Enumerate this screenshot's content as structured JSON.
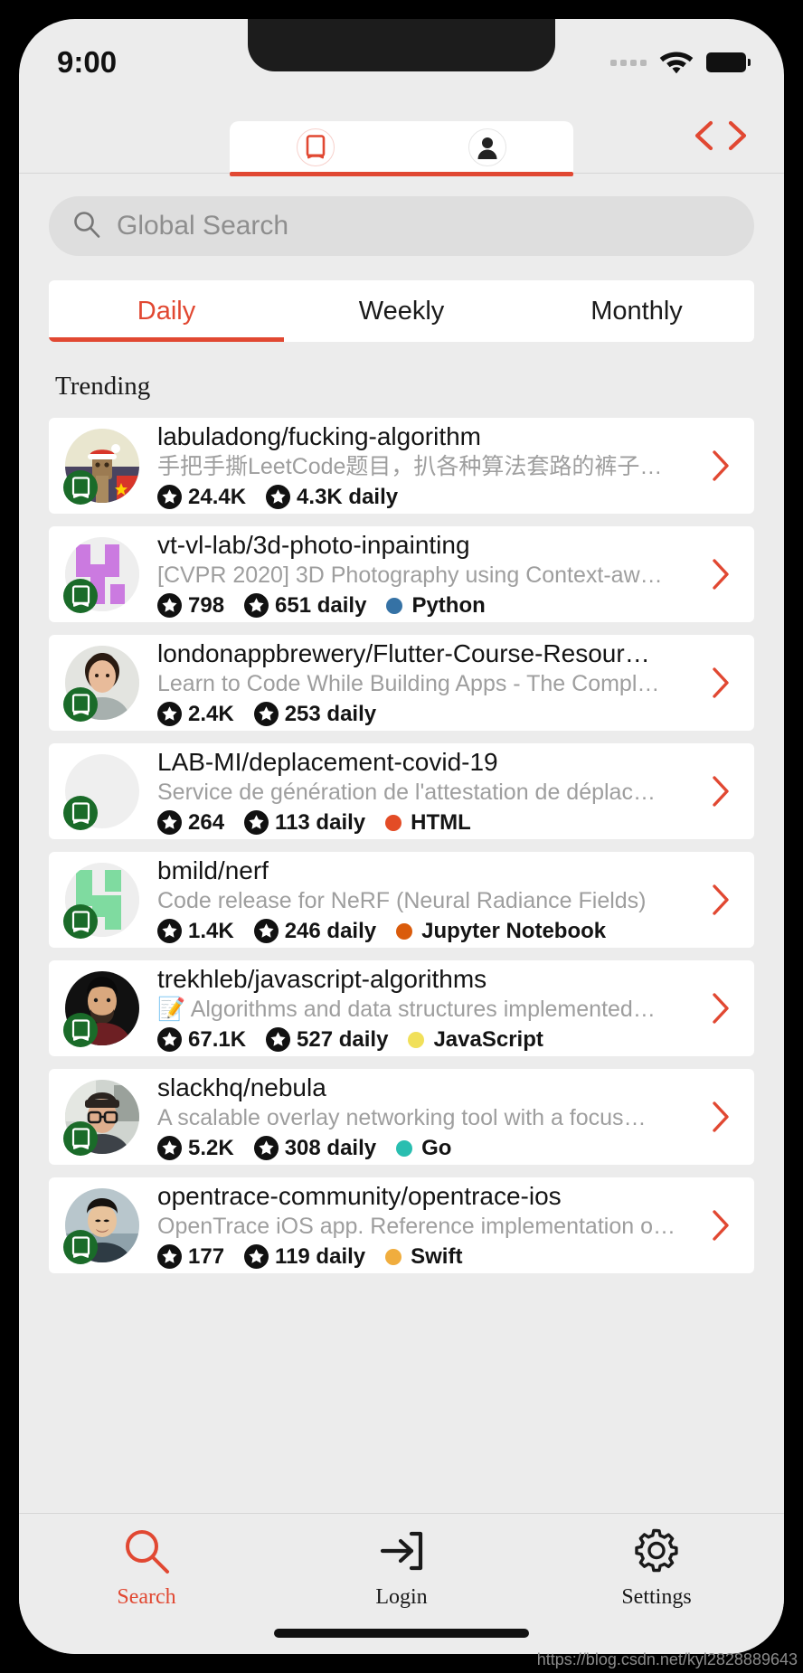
{
  "status_bar": {
    "time": "9:00",
    "signal_icon": "signal-dots-icon",
    "wifi_icon": "wifi-icon",
    "battery_icon": "battery-full-icon"
  },
  "top_tabs": {
    "items": [
      {
        "id": "repos",
        "icon": "book-icon",
        "active": true
      },
      {
        "id": "profile",
        "icon": "person-icon",
        "active": false
      }
    ],
    "code_icon": "code-brackets-icon"
  },
  "search": {
    "placeholder": "Global Search",
    "value": "",
    "icon": "search-icon"
  },
  "period_tabs": {
    "items": [
      {
        "label": "Daily",
        "active": true
      },
      {
        "label": "Weekly",
        "active": false
      },
      {
        "label": "Monthly",
        "active": false
      }
    ]
  },
  "section": {
    "title": "Trending"
  },
  "colors": {
    "accent": "#e14832",
    "badge_green": "#1a6b29",
    "background": "#ececec",
    "card": "#ffffff",
    "muted_text": "#9e9e9e"
  },
  "repos": [
    {
      "name": "labuladong/fucking-algorithm",
      "description": "手把手撕LeetCode题目，扒各种算法套路的裤子…",
      "stars": "24.4K",
      "daily": "4.3K daily",
      "language": "",
      "language_color": "",
      "avatar_style": "danbo-santa",
      "chevron_icon": "chevron-right-icon",
      "badge_icon": "book-badge-icon"
    },
    {
      "name": "vt-vl-lab/3d-photo-inpainting",
      "description": "[CVPR 2020] 3D Photography using Context-aw…",
      "stars": "798",
      "daily": "651 daily",
      "language": "Python",
      "language_color": "#3572a5",
      "avatar_style": "purple-glyph",
      "chevron_icon": "chevron-right-icon",
      "badge_icon": "book-badge-icon"
    },
    {
      "name": "londonappbrewery/Flutter-Course-Resour…",
      "description": "Learn to Code While Building Apps - The Compl…",
      "stars": "2.4K",
      "daily": "253 daily",
      "language": "",
      "language_color": "",
      "avatar_style": "person-photo-1",
      "chevron_icon": "chevron-right-icon",
      "badge_icon": "book-badge-icon"
    },
    {
      "name": "LAB-MI/deplacement-covid-19",
      "description": "Service de génération de l'attestation de déplac…",
      "stars": "264",
      "daily": "113 daily",
      "language": "HTML",
      "language_color": "#e34c26",
      "avatar_style": "none",
      "chevron_icon": "chevron-right-icon",
      "badge_icon": "book-badge-icon"
    },
    {
      "name": "bmild/nerf",
      "description": "Code release for NeRF (Neural Radiance Fields)",
      "stars": "1.4K",
      "daily": "246 daily",
      "language": "Jupyter Notebook",
      "language_color": "#da5b0b",
      "avatar_style": "green-glyph",
      "chevron_icon": "chevron-right-icon",
      "badge_icon": "book-badge-icon"
    },
    {
      "name": "trekhleb/javascript-algorithms",
      "description": "📝 Algorithms and data structures implemented…",
      "stars": "67.1K",
      "daily": "527 daily",
      "language": "JavaScript",
      "language_color": "#f1e05a",
      "avatar_style": "person-photo-2",
      "chevron_icon": "chevron-right-icon",
      "badge_icon": "book-badge-icon"
    },
    {
      "name": "slackhq/nebula",
      "description": "A scalable overlay networking tool with a focus…",
      "stars": "5.2K",
      "daily": "308 daily",
      "language": "Go",
      "language_color": "#29beb0",
      "avatar_style": "person-photo-3",
      "chevron_icon": "chevron-right-icon",
      "badge_icon": "book-badge-icon"
    },
    {
      "name": "opentrace-community/opentrace-ios",
      "description": "OpenTrace iOS app. Reference implementation o…",
      "stars": "177",
      "daily": "119 daily",
      "language": "Swift",
      "language_color": "#f0ad3e",
      "avatar_style": "person-photo-4",
      "chevron_icon": "chevron-right-icon",
      "badge_icon": "book-badge-icon"
    }
  ],
  "bottom_nav": {
    "items": [
      {
        "label": "Search",
        "icon": "search-icon",
        "active": true
      },
      {
        "label": "Login",
        "icon": "login-arrow-icon",
        "active": false
      },
      {
        "label": "Settings",
        "icon": "gear-icon",
        "active": false
      }
    ]
  },
  "watermark": {
    "text": "https://blog.csdn.net/kyl2828889643"
  }
}
